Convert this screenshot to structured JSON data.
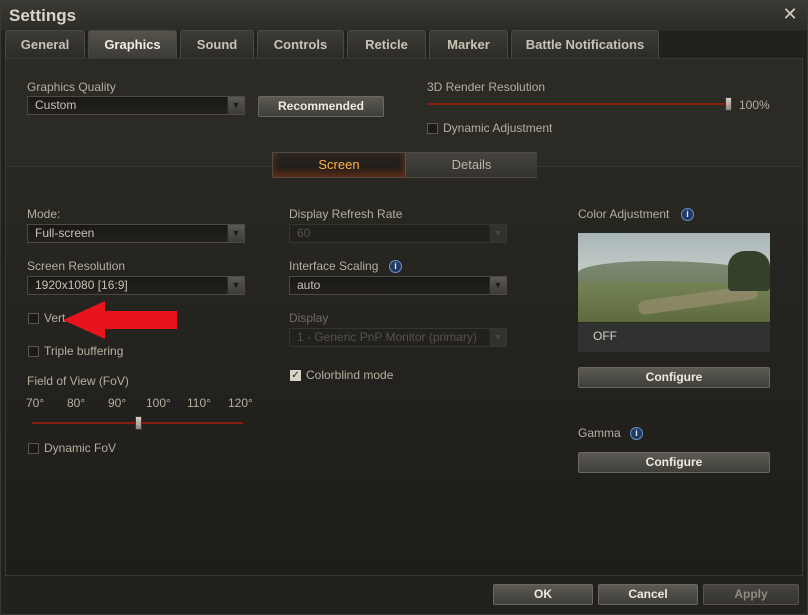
{
  "window": {
    "title": "Settings"
  },
  "tabs": [
    "General",
    "Graphics",
    "Sound",
    "Controls",
    "Reticle",
    "Marker",
    "Battle Notifications"
  ],
  "top": {
    "graphics_quality_label": "Graphics Quality",
    "graphics_quality_value": "Custom",
    "recommended_label": "Recommended",
    "render_resolution_label": "3D Render Resolution",
    "render_resolution_value": "100%",
    "render_resolution_level": 1.0,
    "dynamic_adjustment_label": "Dynamic Adjustment",
    "dynamic_adjustment_checked": false
  },
  "subtabs": {
    "screen": "Screen",
    "details": "Details",
    "active": "Screen"
  },
  "left": {
    "mode_label": "Mode:",
    "mode_value": "Full-screen",
    "resolution_label": "Screen Resolution",
    "resolution_value": "1920x1080 [16:9]",
    "vsync_label": "Vertical sync",
    "vsync_label_visible": "Vert",
    "vsync_checked": false,
    "triple_buffering_label": "Triple buffering",
    "triple_buffering_checked": false,
    "fov_label": "Field of View (FoV)",
    "fov_ticks": [
      "70°",
      "80°",
      "90°",
      "100°",
      "110°",
      "120°"
    ],
    "fov_value_degrees": 95,
    "dynamic_fov_label": "Dynamic FoV",
    "dynamic_fov_checked": false
  },
  "middle": {
    "refresh_rate_label": "Display Refresh Rate",
    "refresh_rate_value": "60",
    "interface_scaling_label": "Interface Scaling",
    "interface_scaling_value": "auto",
    "display_label": "Display",
    "display_value": "1 - Generic PnP Monitor (primary)",
    "colorblind_label": "Colorblind mode",
    "colorblind_checked": true
  },
  "right": {
    "color_adjustment_label": "Color Adjustment",
    "color_adjustment_state": "OFF",
    "configure_label": "Configure",
    "gamma_label": "Gamma",
    "gamma_configure_label": "Configure"
  },
  "footer": {
    "ok": "OK",
    "cancel": "Cancel",
    "apply": "Apply"
  },
  "colors": {
    "accent_orange": "#ffb24a",
    "slider_red": "#8a1d12",
    "annotation_red": "#e8141c",
    "info_blue": "#6d90c4"
  },
  "icons": {
    "close": "close-icon",
    "dropdown": "chevron-down-icon",
    "info": "info-icon",
    "check": "checkmark-icon"
  }
}
